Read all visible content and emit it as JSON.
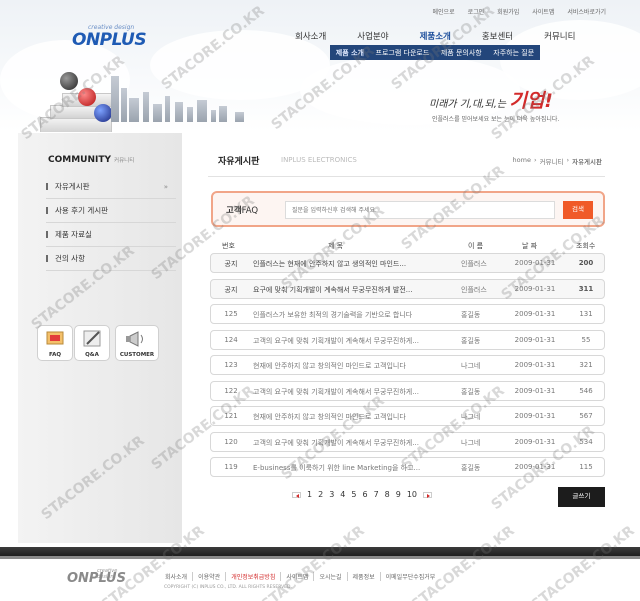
{
  "brand": {
    "logo": "ONPLUS",
    "tagline": "creative design",
    "colors": {
      "brand": "#1f5bb4",
      "accent": "#f05a28",
      "dark": "#23467b"
    }
  },
  "utility": [
    "메인으로",
    "로그인",
    "회원가입",
    "사이트맵",
    "서비스바로가기"
  ],
  "gnb": [
    "회사소개",
    "사업분야",
    "제품소개",
    "홍보센터",
    "커뮤니티"
  ],
  "subnav": [
    "제품 소개",
    "프로그램 다운로드",
    "제품 문의사항",
    "자주하는 질문"
  ],
  "visual": {
    "slogan_pre": "미래가 기,대,되,는",
    "slogan_main": "기업!",
    "slogan_sub": "인플러스를 믿어보세요 보는 눈이 더욱 높아집니다."
  },
  "sidebar": {
    "title": "COMMUNITY",
    "title_sub": "커뮤니티",
    "items": [
      "자유게시판",
      "사용 후기 게시판",
      "제품 자료실",
      "건의 사항"
    ],
    "active_arrow": "»",
    "quick": [
      "FAQ",
      "Q&A",
      "CUSTOMER"
    ]
  },
  "main": {
    "title": "자유게시판",
    "title_en": "INPLUS ELECTRONICS",
    "breadcrumb": [
      "home",
      "›",
      "커뮤니티",
      "›",
      "자유게시판"
    ]
  },
  "search": {
    "label_bold": "고객",
    "label_rest": "FAQ",
    "placeholder": "질문을 입력하신후 검색해 주세요.",
    "button": "검색"
  },
  "table": {
    "headers": [
      "번호",
      "제 목",
      "이 름",
      "날 짜",
      "조회수"
    ],
    "rows": [
      {
        "no": "공지",
        "subject": "인플러스는 현재에 안주하지 않고 생의적인 마인드...",
        "name": "인플러스",
        "date": "2009-01-31",
        "hits": "200",
        "notice": true
      },
      {
        "no": "공지",
        "subject": "요구에 맞춰 기획개발이 계속해서 무궁무진하게 발전...",
        "name": "인플러스",
        "date": "2009-01-31",
        "hits": "311",
        "notice": true
      },
      {
        "no": "125",
        "subject": "인플러스가 보유한 최적의 경기술력을 기반으로 합니다",
        "name": "홍길동",
        "date": "2009-01-31",
        "hits": "131"
      },
      {
        "no": "124",
        "subject": "고객의 요구에 맞춰 기획개발이 계속해서 무궁무진하게...",
        "name": "홍길동",
        "date": "2009-01-31",
        "hits": "55"
      },
      {
        "no": "123",
        "subject": "현재에 안주하지 않고 창의적인 마인드로 고객입니다",
        "name": "나그네",
        "date": "2009-01-31",
        "hits": "321"
      },
      {
        "no": "122",
        "subject": "고객의 요구에 맞춰 기획개발이 계속해서 무궁무진하게...",
        "name": "홍길동",
        "date": "2009-01-31",
        "hits": "546"
      },
      {
        "no": "121",
        "subject": "현재에 안주하지 않고 창의적인 마인드로 고객입니다",
        "name": "나그네",
        "date": "2009-01-31",
        "hits": "567"
      },
      {
        "no": "120",
        "subject": "고객의 요구에 맞춰 기획개발이 계속해서 무궁무진하게...",
        "name": "나그네",
        "date": "2009-01-31",
        "hits": "534"
      },
      {
        "no": "119",
        "subject": "E-business를 이룩하기 위한 line Marketing을 하고...",
        "name": "홍길동",
        "date": "2009-01-31",
        "hits": "115"
      }
    ]
  },
  "pagination": [
    "1",
    "2",
    "3",
    "4",
    "5",
    "6",
    "7",
    "8",
    "9",
    "10"
  ],
  "write_button": "글쓰기",
  "footer": {
    "logo": "ONPLUS",
    "tagline": "creative design",
    "links": [
      "회사소개",
      "이용약관",
      "개인정보취급방침",
      "사이트맵",
      "오시는길",
      "제품정보",
      "이메일무단수집거부"
    ],
    "copyright": "COPYRIGHT (C) INPLUS CO., LTD. ALL RIGHTS RESERVED."
  },
  "watermark": "STACORE.CO.KR"
}
